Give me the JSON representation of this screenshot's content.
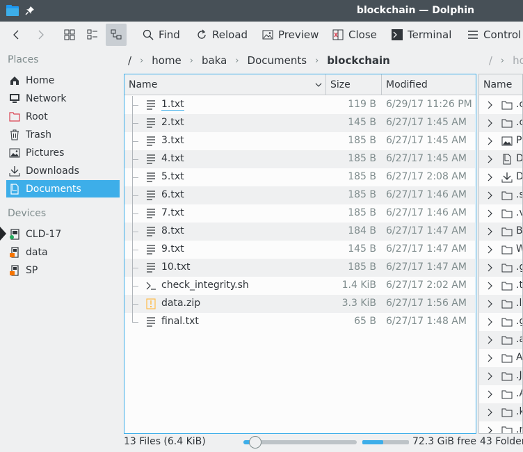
{
  "window": {
    "title": "blockchain — Dolphin"
  },
  "toolbar": {
    "find": "Find",
    "reload": "Reload",
    "preview": "Preview",
    "close": "Close",
    "terminal": "Terminal",
    "control": "Control"
  },
  "sidebar": {
    "places_label": "Places",
    "places": [
      {
        "label": "Home",
        "icon": "home-icon"
      },
      {
        "label": "Network",
        "icon": "network-icon"
      },
      {
        "label": "Root",
        "icon": "root-folder-icon"
      },
      {
        "label": "Trash",
        "icon": "trash-icon"
      },
      {
        "label": "Pictures",
        "icon": "pictures-icon"
      },
      {
        "label": "Downloads",
        "icon": "downloads-icon"
      },
      {
        "label": "Documents",
        "icon": "documents-icon",
        "selected": true
      }
    ],
    "devices_label": "Devices",
    "devices": [
      {
        "label": "CLD-17",
        "icon": "drive-icon"
      },
      {
        "label": "data",
        "icon": "drive-icon"
      },
      {
        "label": "SP",
        "icon": "drive-icon"
      }
    ]
  },
  "breadcrumb": {
    "root": "/",
    "parts": [
      "home",
      "baka",
      "Documents"
    ],
    "current": "blockchain",
    "right_pane_parts": [
      "/",
      "hor"
    ]
  },
  "list": {
    "columns": {
      "name": "Name",
      "size": "Size",
      "modified": "Modified"
    },
    "files": [
      {
        "name": "1.txt",
        "size": "119 B",
        "modified": "6/29/17 11:26 PM",
        "icon": "text-file-icon"
      },
      {
        "name": "2.txt",
        "size": "145 B",
        "modified": "6/27/17 1:45 AM",
        "icon": "text-file-icon"
      },
      {
        "name": "3.txt",
        "size": "185 B",
        "modified": "6/27/17 1:45 AM",
        "icon": "text-file-icon"
      },
      {
        "name": "4.txt",
        "size": "185 B",
        "modified": "6/27/17 1:45 AM",
        "icon": "text-file-icon"
      },
      {
        "name": "5.txt",
        "size": "185 B",
        "modified": "6/27/17 2:08 AM",
        "icon": "text-file-icon"
      },
      {
        "name": "6.txt",
        "size": "185 B",
        "modified": "6/27/17 1:46 AM",
        "icon": "text-file-icon"
      },
      {
        "name": "7.txt",
        "size": "185 B",
        "modified": "6/27/17 1:46 AM",
        "icon": "text-file-icon"
      },
      {
        "name": "8.txt",
        "size": "184 B",
        "modified": "6/27/17 1:47 AM",
        "icon": "text-file-icon"
      },
      {
        "name": "9.txt",
        "size": "145 B",
        "modified": "6/27/17 1:47 AM",
        "icon": "text-file-icon"
      },
      {
        "name": "10.txt",
        "size": "185 B",
        "modified": "6/27/17 1:47 AM",
        "icon": "text-file-icon"
      },
      {
        "name": "check_integrity.sh",
        "size": "1.4 KiB",
        "modified": "6/27/17 2:02 AM",
        "icon": "script-file-icon"
      },
      {
        "name": "data.zip",
        "size": "3.3 KiB",
        "modified": "6/27/17 1:56 AM",
        "icon": "archive-file-icon"
      },
      {
        "name": "final.txt",
        "size": "65 B",
        "modified": "6/27/17 1:48 AM",
        "icon": "text-file-icon"
      }
    ]
  },
  "right_pane": {
    "column_name": "Name",
    "items": [
      {
        "name": ".c",
        "icon": "folder-icon"
      },
      {
        "name": ".c",
        "icon": "folder-icon"
      },
      {
        "name": "P",
        "icon": "pictures-icon"
      },
      {
        "name": "D",
        "icon": "documents-icon"
      },
      {
        "name": "D",
        "icon": "downloads-icon"
      },
      {
        "name": ".s",
        "icon": "folder-icon"
      },
      {
        "name": ".v",
        "icon": "folder-icon"
      },
      {
        "name": "B",
        "icon": "folder-icon"
      },
      {
        "name": "W",
        "icon": "folder-icon"
      },
      {
        "name": ".g",
        "icon": "folder-icon"
      },
      {
        "name": ".t",
        "icon": "folder-icon"
      },
      {
        "name": ".l",
        "icon": "folder-icon"
      },
      {
        "name": ".g",
        "icon": "folder-icon"
      },
      {
        "name": ".a",
        "icon": "folder-icon"
      },
      {
        "name": "A",
        "icon": "folder-icon"
      },
      {
        "name": ".J",
        "icon": "folder-icon"
      },
      {
        "name": ".A",
        "icon": "folder-icon"
      },
      {
        "name": ".k",
        "icon": "folder-icon"
      },
      {
        "name": ".n",
        "icon": "folder-icon"
      }
    ]
  },
  "status": {
    "summary": "13 Files (6.4 KiB)",
    "zoom_level": 0.1,
    "disk_usage": 0.45,
    "free_space": "72.3 GiB free",
    "right_summary": "43 Folder"
  },
  "colors": {
    "accent": "#3daee9",
    "titlebar": "#475057",
    "alt_row": "#eff0f1"
  }
}
